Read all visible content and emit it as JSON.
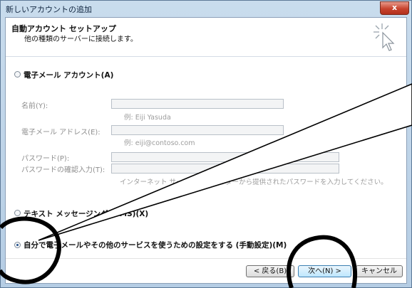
{
  "window": {
    "title": "新しいアカウントの追加",
    "close_label": "x"
  },
  "header": {
    "title": "自動アカウント セットアップ",
    "subtitle": "他の種類のサーバーに接続します。",
    "icon": "wizard-cursor-icon"
  },
  "options": {
    "email_account": {
      "label": "電子メール アカウント(A)",
      "checked": false
    },
    "text_messaging": {
      "label": "テキスト メッセージング (SMS)(X)",
      "checked": false
    },
    "manual": {
      "label": "自分で電子メールやその他のサービスを使うための設定をする (手動設定)(M)",
      "checked": true
    }
  },
  "fields": {
    "name": {
      "label": "名前(Y):",
      "value": "",
      "hint": "例: Eiji Yasuda"
    },
    "email": {
      "label": "電子メール アドレス(E):",
      "value": "",
      "hint": "例: eiji@contoso.com"
    },
    "password": {
      "label": "パスワード(P):",
      "value": ""
    },
    "password_confirm": {
      "label": "パスワードの確認入力(T):",
      "value": ""
    },
    "password_hint": "インターネット サービス プロバイダーから提供されたパスワードを入力してください。"
  },
  "buttons": {
    "back": "< 戻る(B)",
    "next": "次へ(N) >",
    "cancel": "キャンセル"
  },
  "colors": {
    "titlebar": "#b5cde4",
    "close": "#c7432e",
    "annotation": "#000000"
  }
}
